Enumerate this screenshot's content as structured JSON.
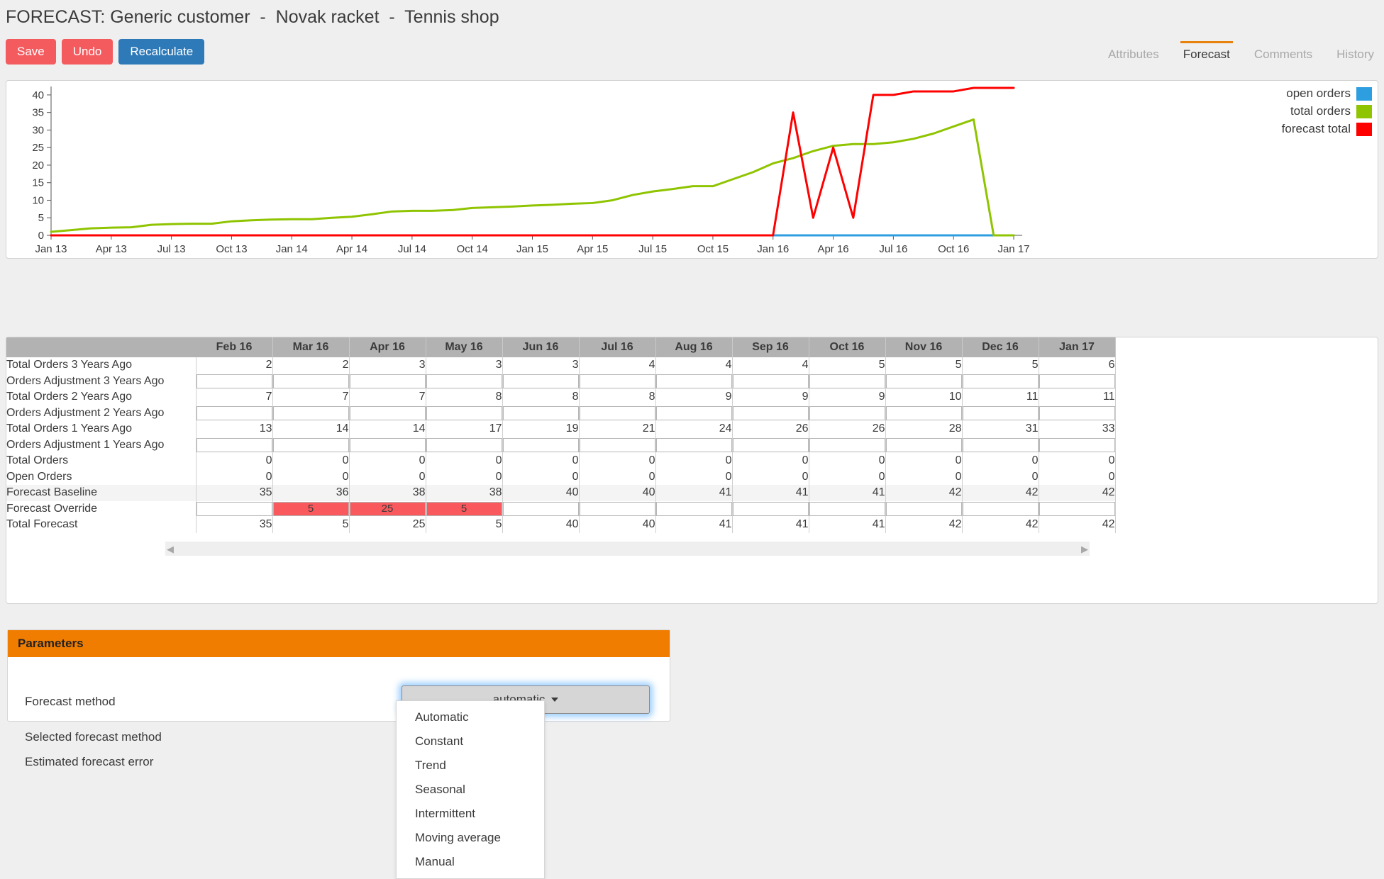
{
  "header": {
    "title": "FORECAST: Generic customer  -  Novak racket  -  Tennis shop",
    "buttons": [
      {
        "label": "Save",
        "style": "red"
      },
      {
        "label": "Undo",
        "style": "red"
      },
      {
        "label": "Recalculate",
        "style": "blue"
      }
    ],
    "tabs": [
      {
        "label": "Attributes",
        "active": false
      },
      {
        "label": "Forecast",
        "active": true
      },
      {
        "label": "Comments",
        "active": false
      },
      {
        "label": "History",
        "active": false
      }
    ]
  },
  "chart_data": {
    "type": "line",
    "title": "",
    "xlabel": "",
    "ylabel": "",
    "ylim": [
      0,
      42
    ],
    "yticks": [
      0,
      5,
      10,
      15,
      20,
      25,
      30,
      35,
      40
    ],
    "grid": false,
    "legend_position": "top-right",
    "xticks": [
      "Jan 13",
      "Apr 13",
      "Jul 13",
      "Oct 13",
      "Jan 14",
      "Apr 14",
      "Jul 14",
      "Oct 14",
      "Jan 15",
      "Apr 15",
      "Jul 15",
      "Oct 15",
      "Jan 16",
      "Apr 16",
      "Jul 16",
      "Oct 16",
      "Jan 17"
    ],
    "x": [
      "Jan 13",
      "Feb 13",
      "Mar 13",
      "Apr 13",
      "May 13",
      "Jun 13",
      "Jul 13",
      "Aug 13",
      "Sep 13",
      "Oct 13",
      "Nov 13",
      "Dec 13",
      "Jan 14",
      "Feb 14",
      "Mar 14",
      "Apr 14",
      "May 14",
      "Jun 14",
      "Jul 14",
      "Aug 14",
      "Sep 14",
      "Oct 14",
      "Nov 14",
      "Dec 14",
      "Jan 15",
      "Feb 15",
      "Mar 15",
      "Apr 15",
      "May 15",
      "Jun 15",
      "Jul 15",
      "Aug 15",
      "Sep 15",
      "Oct 15",
      "Nov 15",
      "Dec 15",
      "Jan 16",
      "Feb 16",
      "Mar 16",
      "Apr 16",
      "May 16",
      "Jun 16",
      "Jul 16",
      "Aug 16",
      "Sep 16",
      "Oct 16",
      "Nov 16",
      "Dec 16",
      "Jan 17"
    ],
    "series": [
      {
        "name": "open orders",
        "color": "#2d9ee0",
        "values": [
          0,
          0,
          0,
          0,
          0,
          0,
          0,
          0,
          0,
          0,
          0,
          0,
          0,
          0,
          0,
          0,
          0,
          0,
          0,
          0,
          0,
          0,
          0,
          0,
          0,
          0,
          0,
          0,
          0,
          0,
          0,
          0,
          0,
          0,
          0,
          0,
          0,
          0,
          0,
          0,
          0,
          0,
          0,
          0,
          0,
          0,
          0,
          0,
          0
        ]
      },
      {
        "name": "total orders",
        "color": "#8fc400",
        "values": [
          1,
          1.5,
          2,
          2.2,
          2.3,
          3,
          3.2,
          3.3,
          3.3,
          4,
          4.3,
          4.5,
          4.6,
          4.6,
          5,
          5.3,
          6,
          6.8,
          7,
          7,
          7.2,
          7.8,
          8,
          8.2,
          8.5,
          8.7,
          9,
          9.2,
          10,
          11.5,
          12.5,
          13.2,
          14,
          14,
          16,
          18,
          20.5,
          22,
          24,
          25.5,
          26,
          26,
          26.5,
          27.5,
          29,
          31,
          33,
          0,
          0
        ]
      },
      {
        "name": "forecast total",
        "color": "#ff0000",
        "values": [
          0,
          0,
          0,
          0,
          0,
          0,
          0,
          0,
          0,
          0,
          0,
          0,
          0,
          0,
          0,
          0,
          0,
          0,
          0,
          0,
          0,
          0,
          0,
          0,
          0,
          0,
          0,
          0,
          0,
          0,
          0,
          0,
          0,
          0,
          0,
          0,
          0,
          35,
          5,
          25,
          5,
          40,
          40,
          41,
          41,
          41,
          42,
          42,
          42
        ]
      }
    ]
  },
  "table": {
    "months": [
      "Feb 16",
      "Mar 16",
      "Apr 16",
      "May 16",
      "Jun 16",
      "Jul 16",
      "Aug 16",
      "Sep 16",
      "Oct 16",
      "Nov 16",
      "Dec 16",
      "Jan 17"
    ],
    "rows": [
      {
        "label": "Total Orders 3 Years Ago",
        "type": "readonly",
        "shaded": false,
        "values": [
          "2",
          "2",
          "3",
          "3",
          "3",
          "4",
          "4",
          "4",
          "5",
          "5",
          "5",
          "6"
        ]
      },
      {
        "label": "Orders Adjustment 3 Years Ago",
        "type": "input",
        "shaded": false,
        "values": [
          "",
          "",
          "",
          "",
          "",
          "",
          "",
          "",
          "",
          "",
          "",
          ""
        ]
      },
      {
        "label": "Total Orders 2 Years Ago",
        "type": "readonly",
        "shaded": false,
        "values": [
          "7",
          "7",
          "7",
          "8",
          "8",
          "8",
          "9",
          "9",
          "9",
          "10",
          "11",
          "11"
        ]
      },
      {
        "label": "Orders Adjustment 2 Years Ago",
        "type": "input",
        "shaded": false,
        "values": [
          "",
          "",
          "",
          "",
          "",
          "",
          "",
          "",
          "",
          "",
          "",
          ""
        ]
      },
      {
        "label": "Total Orders 1 Years Ago",
        "type": "readonly",
        "shaded": false,
        "values": [
          "13",
          "14",
          "14",
          "17",
          "19",
          "21",
          "24",
          "26",
          "26",
          "28",
          "31",
          "33"
        ]
      },
      {
        "label": "Orders Adjustment 1 Years Ago",
        "type": "input",
        "shaded": false,
        "values": [
          "",
          "",
          "",
          "",
          "",
          "",
          "",
          "",
          "",
          "",
          "",
          ""
        ]
      },
      {
        "label": "Total Orders",
        "type": "readonly",
        "shaded": false,
        "values": [
          "0",
          "0",
          "0",
          "0",
          "0",
          "0",
          "0",
          "0",
          "0",
          "0",
          "0",
          "0"
        ]
      },
      {
        "label": "Open Orders",
        "type": "readonly",
        "shaded": false,
        "values": [
          "0",
          "0",
          "0",
          "0",
          "0",
          "0",
          "0",
          "0",
          "0",
          "0",
          "0",
          "0"
        ]
      },
      {
        "label": "Forecast Baseline",
        "type": "readonly",
        "shaded": true,
        "values": [
          "35",
          "36",
          "38",
          "38",
          "40",
          "40",
          "41",
          "41",
          "41",
          "42",
          "42",
          "42"
        ]
      },
      {
        "label": "Forecast Override",
        "type": "input",
        "shaded": false,
        "values": [
          "",
          "5",
          "25",
          "5",
          "",
          "",
          "",
          "",
          "",
          "",
          "",
          ""
        ]
      },
      {
        "label": "Total Forecast",
        "type": "readonly",
        "shaded": false,
        "values": [
          "35",
          "5",
          "25",
          "5",
          "40",
          "40",
          "41",
          "41",
          "41",
          "42",
          "42",
          "42"
        ]
      }
    ],
    "scroll_left_icon": "◀",
    "scroll_right_icon": "▶"
  },
  "parameters": {
    "panel_title": "Parameters",
    "labels": {
      "forecast_method": "Forecast method",
      "selected_forecast_method": "Selected forecast method",
      "estimated_forecast_error": "Estimated forecast error"
    },
    "values": {
      "selected_forecast_method": "",
      "estimated_forecast_error": ""
    },
    "method_select": {
      "value": "automatic",
      "options": [
        "Automatic",
        "Constant",
        "Trend",
        "Seasonal",
        "Intermittent",
        "Moving average",
        "Manual"
      ]
    }
  },
  "colors": {
    "accent_orange": "#f07c00",
    "button_red": "#f45b5f",
    "button_blue": "#2e7ab8",
    "override_red": "#f9585c",
    "open_orders": "#2d9ee0",
    "total_orders": "#8fc400",
    "forecast_total": "#ff0000"
  }
}
